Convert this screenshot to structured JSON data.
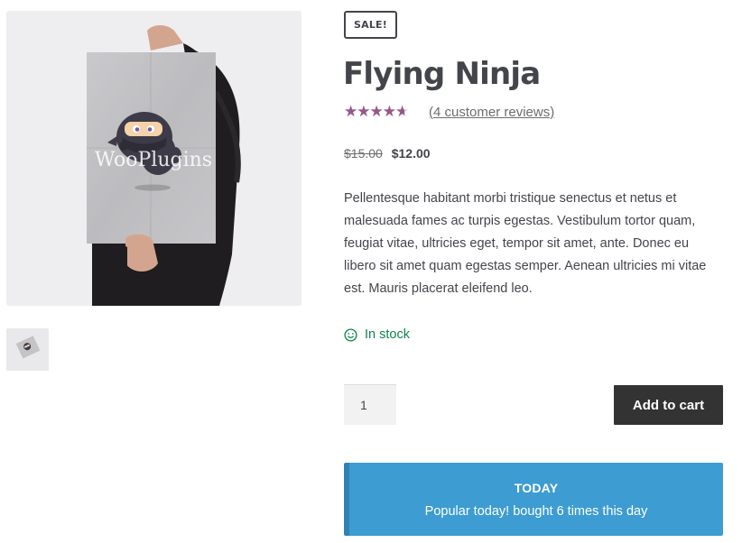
{
  "gallery": {
    "main_image_watermark": "WooPlugins",
    "main_image_alt": "Poster of a ninja mascot held by a person",
    "thumbnail_alt": "Flying Ninja poster thumbnail"
  },
  "product": {
    "sale_badge": "SALE!",
    "title": "Flying Ninja",
    "rating": 4,
    "rating_max": 5,
    "reviews_link": "(4 customer reviews)",
    "price_old": "$15.00",
    "price_new": "$12.00",
    "description": "Pellentesque habitant morbi tristique senectus et netus et malesuada fames ac turpis egestas. Vestibulum tortor quam, feugiat vitae, ultricies eget, tempor sit amet, ante. Donec eu libero sit amet quam egestas semper. Aenean ultricies mi vitae est. Mauris placerat eleifend leo.",
    "stock_icon": "smile-icon",
    "stock_text": "In stock",
    "quantity": "1",
    "add_to_cart_label": "Add to cart"
  },
  "popular": {
    "title": "TODAY",
    "text": "Popular today! bought 6 times this day"
  },
  "colors": {
    "text": "#43454b",
    "star_filled": "#96588a",
    "star_empty": "#d1d1d1",
    "in_stock": "#0f834d",
    "cart_button": "#333333",
    "popular_bg": "#3d9cd2",
    "popular_border": "#2f83b3"
  }
}
